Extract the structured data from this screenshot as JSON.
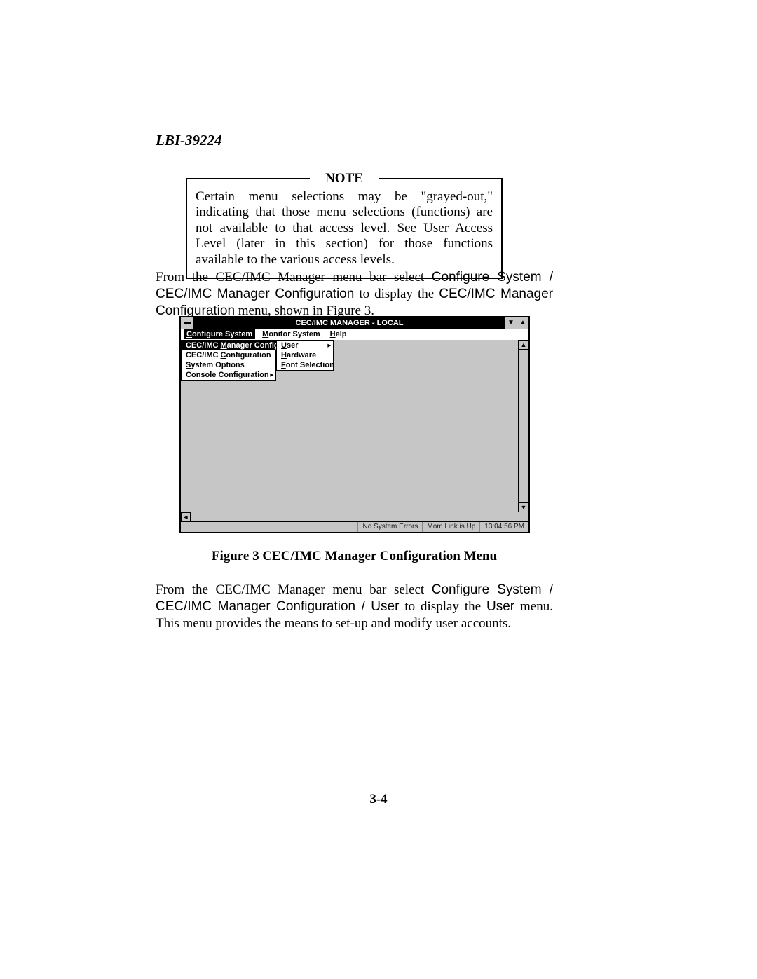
{
  "header_id": "LBI-39224",
  "note": {
    "label": "NOTE",
    "text": "Certain menu selections may be \"grayed-out,\" indicating that those menu selections (functions) are not available to that access level.  See User Access Level (later in this section) for those functions available to the various access levels."
  },
  "para1": {
    "a": "From the CEC/IMC Manager menu bar select ",
    "b": "Configure System / CEC/IMC Manager Configuration",
    "c": " to display the ",
    "d": "CEC/IMC Manager Configuration",
    "e": " menu, shown in Figure 3."
  },
  "caption": "Figure 3  CEC/IMC Manager Configuration Menu",
  "para2": {
    "a": "From the CEC/IMC Manager menu bar select ",
    "b": "Configure System / CEC/IMC Manager Configuration / User",
    "c": " to display the ",
    "d": "User",
    "e": " menu. This menu provides the means to set-up and modify user accounts."
  },
  "page_num": "3-4",
  "app": {
    "title": "CEC/IMC MANAGER - LOCAL",
    "menubar": {
      "items": [
        {
          "pre": "",
          "ul": "C",
          "post": "onfigure System",
          "selected": true
        },
        {
          "pre": "",
          "ul": "M",
          "post": "onitor System",
          "selected": false
        },
        {
          "pre": "",
          "ul": "H",
          "post": "elp",
          "selected": false
        }
      ]
    },
    "dropdown1": {
      "items": [
        {
          "pre": "CEC/IMC ",
          "ul": "M",
          "post": "anager Configuration",
          "selected": true,
          "submenu": true
        },
        {
          "pre": "CEC/IMC ",
          "ul": "C",
          "post": "onfiguration",
          "selected": false,
          "submenu": false
        },
        {
          "pre": "",
          "ul": "S",
          "post": "ystem Options",
          "selected": false,
          "submenu": false
        },
        {
          "pre": "C",
          "ul": "o",
          "post": "nsole Configuration",
          "selected": false,
          "submenu": true
        }
      ]
    },
    "dropdown2": {
      "items": [
        {
          "pre": "",
          "ul": "U",
          "post": "ser",
          "selected": false,
          "submenu": true
        },
        {
          "pre": "",
          "ul": "H",
          "post": "ardware",
          "selected": false,
          "submenu": false
        },
        {
          "pre": "",
          "ul": "F",
          "post": "ont Selection",
          "selected": false,
          "submenu": false
        }
      ]
    },
    "status": {
      "errors": "No System Errors",
      "link": "Mom Link is Up",
      "time": "13:04:56 PM"
    },
    "glyph": {
      "up": "▲",
      "down": "▼",
      "left": "◄",
      "right": "▸"
    }
  }
}
